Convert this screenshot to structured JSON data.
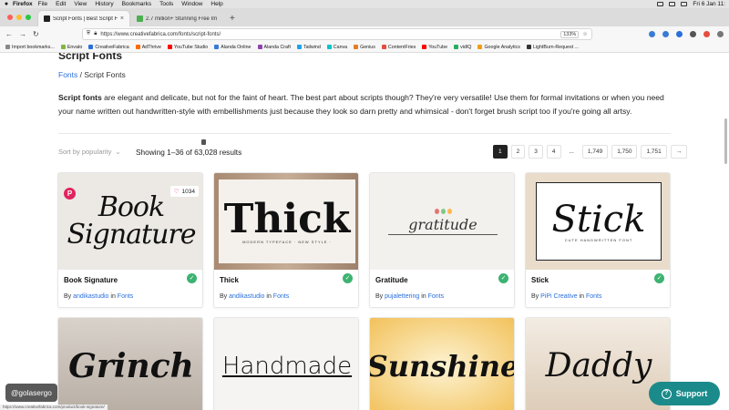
{
  "menubar": {
    "app": "Firefox",
    "items": [
      "File",
      "Edit",
      "View",
      "History",
      "Bookmarks",
      "Tools",
      "Window",
      "Help"
    ],
    "clock": "Fri 6 Jan 11:"
  },
  "tabs": [
    {
      "title": "Script Fonts | Best Script Fonts",
      "active": true,
      "color": "#ffffff"
    },
    {
      "title": "2.7 million+ Stunning Free Imag",
      "active": false,
      "color": "#4caf50"
    }
  ],
  "url": "https://www.creativefabrica.com/fonts/script-fonts/",
  "zoom": "133%",
  "bookmarks": [
    {
      "label": "Import bookmarks...",
      "color": "#888888"
    },
    {
      "label": "Envato",
      "color": "#82b541"
    },
    {
      "label": "CreativeFabrica",
      "color": "#2a6fdb"
    },
    {
      "label": "AdThrive",
      "color": "#ff6a00"
    },
    {
      "label": "YouTube Studio",
      "color": "#ff0000"
    },
    {
      "label": "Alanda Online",
      "color": "#3a7bd5"
    },
    {
      "label": "Alanda Craft",
      "color": "#8e44ad"
    },
    {
      "label": "Tailwind",
      "color": "#1da1f2"
    },
    {
      "label": "Canva",
      "color": "#00c4cc"
    },
    {
      "label": "Genius",
      "color": "#e67e22"
    },
    {
      "label": "ContentFries",
      "color": "#e74c3c"
    },
    {
      "label": "YouTube",
      "color": "#ff0000"
    },
    {
      "label": "vidIQ",
      "color": "#27ae60"
    },
    {
      "label": "Google Analytics",
      "color": "#f39c12"
    },
    {
      "label": "LightBurn-Request ...",
      "color": "#333333"
    }
  ],
  "page": {
    "title": "Script Fonts",
    "breadcrumb": {
      "home": "Fonts",
      "sep": "/",
      "current": "Script Fonts"
    },
    "description_bold": "Script fonts",
    "description_rest": " are elegant and delicate, but not for the faint of heart. The best part about scripts though? They're very versatile! Use them for formal invitations or when you need your name written out handwritten-style with embellishments just because they look so darn pretty and whimsical - don't forget brush script too if you're going all artsy.",
    "sort_label": "Sort by popularity",
    "results": "Showing 1–36 of 63,028 results",
    "pagination": [
      "1",
      "2",
      "3",
      "4",
      "...",
      "1,749",
      "1,750",
      "1,751",
      "→"
    ]
  },
  "cards": [
    {
      "name": "Book Signature",
      "by": "By",
      "author": "andikastudio",
      "in": "in",
      "category": "Fonts",
      "preview": "Book Signature",
      "likes": "1034",
      "bg": "#ece9e4"
    },
    {
      "name": "Thick",
      "by": "By",
      "author": "andikastudio",
      "in": "in",
      "category": "Fonts",
      "preview": "Thick",
      "sub": "MODERN TYPEFACE · NEW STYLE ·",
      "bg": "#b79d86"
    },
    {
      "name": "Gratitude",
      "by": "By",
      "author": "pujalettering",
      "in": "in",
      "category": "Fonts",
      "preview": "gratitude",
      "bg": "#f3f1ee"
    },
    {
      "name": "Stick",
      "by": "By",
      "author": "PiPi Creative",
      "in": "in",
      "category": "Fonts",
      "preview": "Stick",
      "sub": "CUTE HANDWRITTEN FONT",
      "bg": "#e9dccb"
    }
  ],
  "cards_row2": [
    {
      "preview": "Grinch",
      "bg": "#c9c3bd"
    },
    {
      "preview": "Handmade",
      "bg": "#f5f4f2"
    },
    {
      "preview": "Sunshine",
      "bg": "#f6d98c"
    },
    {
      "preview": "Daddy",
      "bg": "#efe6da"
    }
  ],
  "overlay": {
    "handle": "@golasergo",
    "support": "Support"
  },
  "status": "https://www.creativefabrica.com/product/book-signature/"
}
